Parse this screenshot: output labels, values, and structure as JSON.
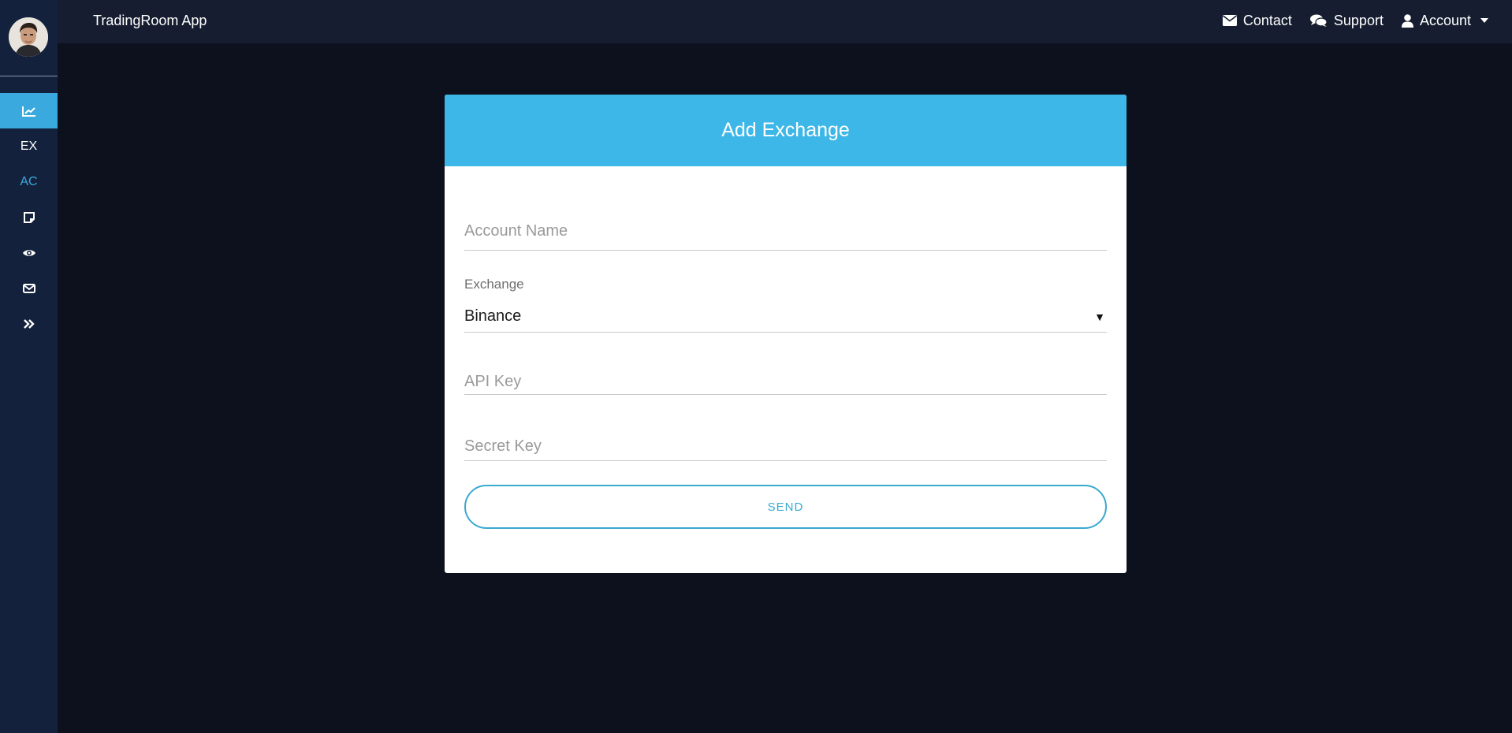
{
  "topbar": {
    "app_title": "TradingRoom App",
    "links": [
      {
        "label": "Contact",
        "icon": "envelope-icon"
      },
      {
        "label": "Support",
        "icon": "comments-icon"
      },
      {
        "label": "Account",
        "icon": "user-icon"
      }
    ]
  },
  "sidebar": {
    "items": [
      {
        "icon": "chart-icon",
        "active": true
      },
      {
        "label": "EX"
      },
      {
        "label": "AC",
        "accent": true
      },
      {
        "icon": "note-icon"
      },
      {
        "icon": "eye-icon"
      },
      {
        "icon": "envelope-icon"
      },
      {
        "icon": "double-chevron-right-icon"
      }
    ]
  },
  "form": {
    "title": "Add Exchange",
    "account_name_placeholder": "Account Name",
    "exchange_label": "Exchange",
    "exchange_selected": "Binance",
    "api_key_placeholder": "API Key",
    "secret_key_placeholder": "Secret Key",
    "send_label": "SEND"
  },
  "colors": {
    "accent": "#3db7e7",
    "sidebar_bg": "#13213c",
    "topbar_bg": "#161d30",
    "page_bg": "#0c111d"
  }
}
